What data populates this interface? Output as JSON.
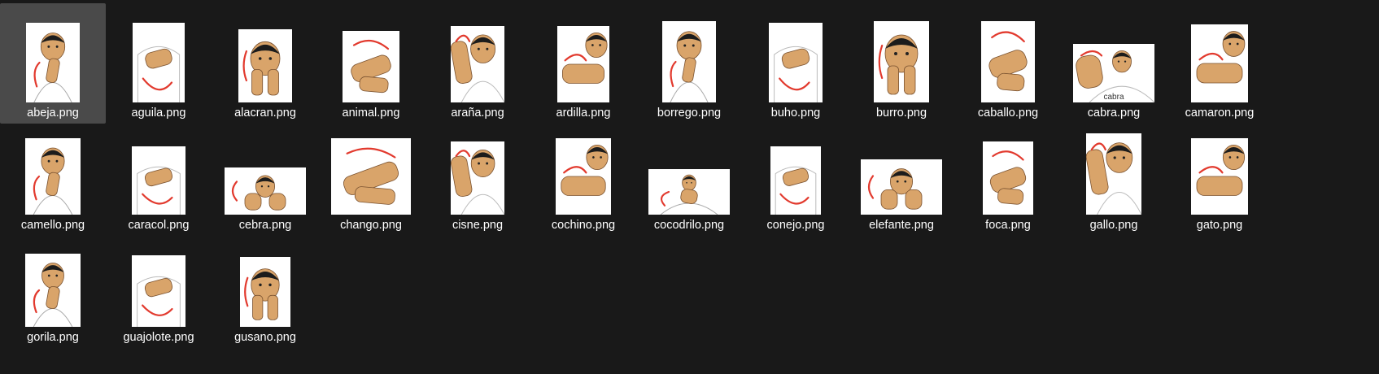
{
  "files": [
    {
      "name": "abeja.png",
      "selected": true
    },
    {
      "name": "aguila.png"
    },
    {
      "name": "alacran.png"
    },
    {
      "name": "animal.png"
    },
    {
      "name": "araña.png"
    },
    {
      "name": "ardilla.png"
    },
    {
      "name": "borrego.png"
    },
    {
      "name": "buho.png"
    },
    {
      "name": "burro.png"
    },
    {
      "name": "caballo.png"
    },
    {
      "name": "cabra.png",
      "caption": "cabra"
    },
    {
      "name": "camaron.png"
    },
    {
      "name": "camello.png"
    },
    {
      "name": "caracol.png"
    },
    {
      "name": "cebra.png"
    },
    {
      "name": "chango.png"
    },
    {
      "name": "cisne.png"
    },
    {
      "name": "cochino.png"
    },
    {
      "name": "cocodrilo.png"
    },
    {
      "name": "conejo.png"
    },
    {
      "name": "elefante.png"
    },
    {
      "name": "foca.png"
    },
    {
      "name": "gallo.png"
    },
    {
      "name": "gato.png"
    },
    {
      "name": "gorila.png"
    },
    {
      "name": "guajolote.png"
    },
    {
      "name": "gusano.png"
    }
  ],
  "colors": {
    "background": "#191919",
    "selected_tile": "#4a4a4a",
    "label_text": "#ffffff",
    "skin": "#d9a46a",
    "hair": "#1c1c1c",
    "arrow": "#e23a2e"
  }
}
